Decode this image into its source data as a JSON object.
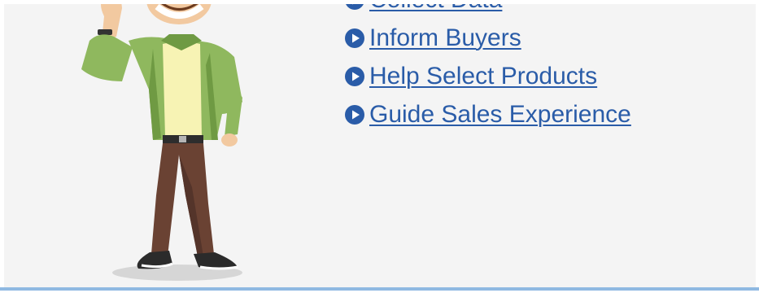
{
  "links": [
    {
      "label": "Collect Data",
      "icon": "play-circle-icon"
    },
    {
      "label": "Inform Buyers",
      "icon": "play-circle-icon"
    },
    {
      "label": "Help Select Products",
      "icon": "play-circle-icon"
    },
    {
      "label": "Guide Sales Experience",
      "icon": "play-circle-icon"
    }
  ],
  "colors": {
    "link": "#2a5ca8",
    "panel_background": "#f4f4f4",
    "bottom_rule": "#8fb9e2"
  }
}
